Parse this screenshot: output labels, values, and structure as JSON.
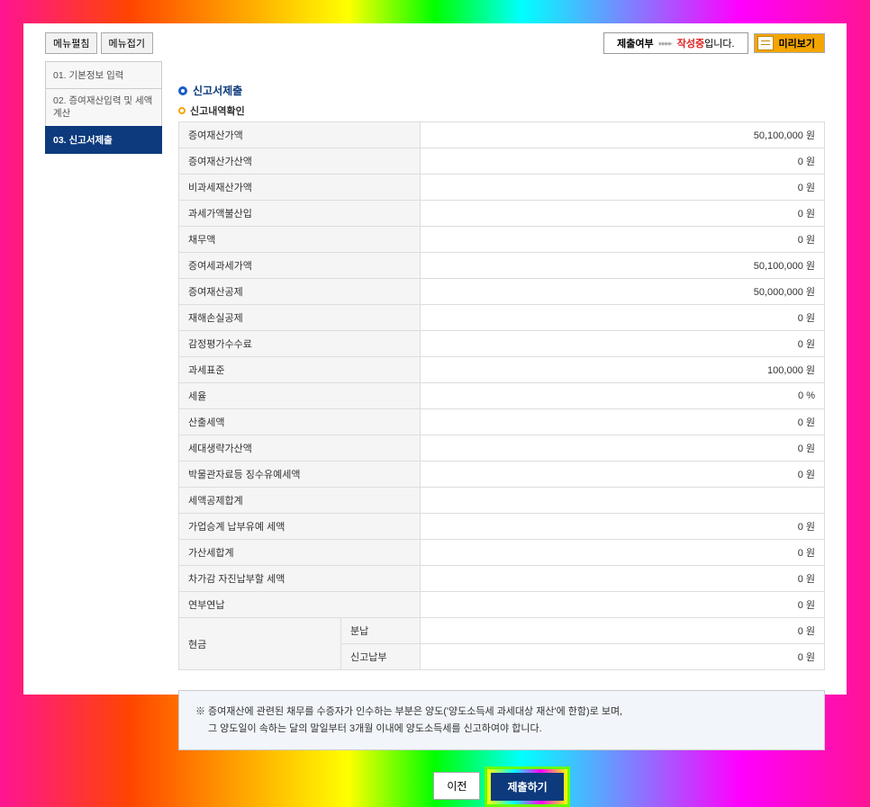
{
  "topbar": {
    "menu_expand": "메뉴펼침",
    "menu_collapse": "메뉴접기",
    "status_label": "제출여부",
    "status_value": "작성중",
    "status_suffix": "입니다.",
    "preview": "미리보기"
  },
  "sidebar": {
    "items": [
      {
        "label": "01. 기본정보 입력"
      },
      {
        "label": "02. 증여재산입력 및 세액계산"
      },
      {
        "label": "03. 신고서제출"
      }
    ]
  },
  "section": {
    "title": "신고서제출",
    "subtitle": "신고내역확인"
  },
  "rows": [
    {
      "label": "증여재산가액",
      "value": "50,100,000 원"
    },
    {
      "label": "증여재산가산액",
      "value": "0 원"
    },
    {
      "label": "비과세재산가액",
      "value": "0 원"
    },
    {
      "label": "과세가액불산입",
      "value": "0 원"
    },
    {
      "label": "채무액",
      "value": "0 원"
    },
    {
      "label": "증여세과세가액",
      "value": "50,100,000 원"
    },
    {
      "label": "증여재산공제",
      "value": "50,000,000 원"
    },
    {
      "label": "재해손실공제",
      "value": "0 원"
    },
    {
      "label": "감정평가수수료",
      "value": "0 원"
    },
    {
      "label": "과세표준",
      "value": "100,000 원"
    },
    {
      "label": "세율",
      "value": "0 %"
    },
    {
      "label": "산출세액",
      "value": "0 원"
    },
    {
      "label": "세대생략가산액",
      "value": "0 원"
    },
    {
      "label": "박물관자료등 징수유예세액",
      "value": "0 원"
    },
    {
      "label": "세액공제합계",
      "value": ""
    },
    {
      "label": "가업승계 납부유예 세액",
      "value": "0 원"
    },
    {
      "label": "가산세합계",
      "value": "0 원"
    },
    {
      "label": "차가감 자진납부할 세액",
      "value": "0 원"
    },
    {
      "label": "연부연납",
      "value": "0 원"
    }
  ],
  "cash": {
    "label": "현금",
    "subrows": [
      {
        "label": "분납",
        "value": "0 원"
      },
      {
        "label": "신고납부",
        "value": "0 원"
      }
    ]
  },
  "note": {
    "line1": "※ 증여재산에 관련된 채무를 수증자가 인수하는 부분은 양도('양도소득세 과세대상 재산'에 한함)로 보며,",
    "line2": "그 양도일이 속하는 달의 말일부터 3개월 이내에 양도소득세를 신고하여야 합니다."
  },
  "actions": {
    "prev": "이전",
    "submit": "제출하기"
  }
}
